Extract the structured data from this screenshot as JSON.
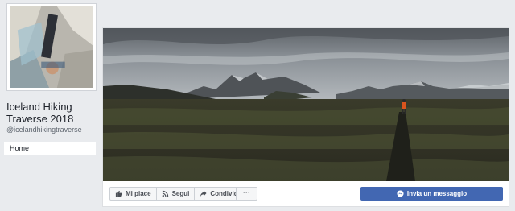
{
  "page": {
    "name": "Iceland Hiking Traverse 2018",
    "handle": "@icelandhikingtraverse"
  },
  "nav": {
    "items": [
      {
        "label": "Home"
      }
    ]
  },
  "actions": {
    "like_label": "Mi piace",
    "follow_label": "Segui",
    "share_label": "Condividi",
    "more_label": "···",
    "message_label": "Invia un messaggio"
  },
  "icons": {
    "like": "thumbs-up-icon",
    "follow": "rss-icon",
    "share": "share-arrow-icon",
    "message": "messenger-icon"
  },
  "colors": {
    "page_background": "#e9ebee",
    "brand_blue": "#4267b2",
    "button_text": "#4b4f56"
  }
}
